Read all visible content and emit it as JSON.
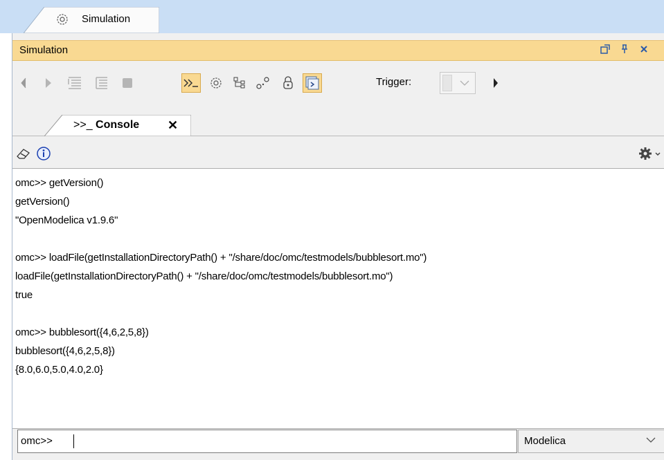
{
  "top_tab": {
    "label": "Simulation",
    "icon": "simulation-gear-icon"
  },
  "window": {
    "title": "Simulation",
    "buttons": [
      {
        "name": "restore-button",
        "glyph": "⇱"
      },
      {
        "name": "pin-button",
        "glyph": "⊥"
      },
      {
        "name": "close-button",
        "glyph": "✕"
      }
    ]
  },
  "toolbar": {
    "icons": [
      "back-icon",
      "play-icon",
      "step-into-icon",
      "step-over-icon",
      "stop-icon",
      "console-icon",
      "sim-gear-icon",
      "tree-icon",
      "nodes-icon",
      "lock-icon",
      "export-icon"
    ],
    "trigger_label": "Trigger:",
    "active_color": "#f9d992"
  },
  "console_tab": {
    "prefix": ">>_",
    "label": "Console",
    "close": "✕"
  },
  "console_toolbar": {
    "icons": [
      "eraser-icon",
      "info-icon",
      "settings-gear-icon"
    ]
  },
  "output": {
    "lines": [
      "omc>> getVersion()",
      "getVersion()",
      "\"OpenModelica v1.9.6\"",
      "",
      "omc>> loadFile(getInstallationDirectoryPath() + \"/share/doc/omc/testmodels/bubblesort.mo\")",
      "loadFile(getInstallationDirectoryPath() + \"/share/doc/omc/testmodels/bubblesort.mo\")",
      "true",
      "",
      "omc>> bubblesort({4,6,2,5,8})",
      "bubblesort({4,6,2,5,8})",
      "{8.0,6.0,5.0,4.0,2.0}"
    ]
  },
  "input": {
    "prompt": "omc>>",
    "value": ""
  },
  "language_select": {
    "value": "Modelica"
  }
}
